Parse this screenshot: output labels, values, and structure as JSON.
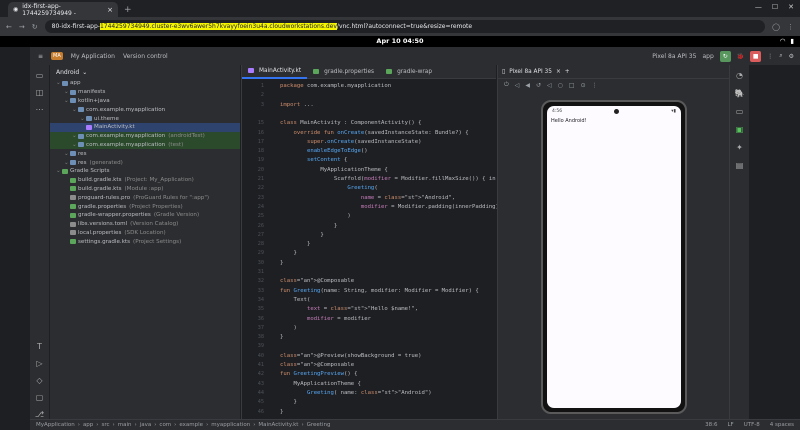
{
  "browser": {
    "tab_title": "idx-first-app-1744259734949 - ",
    "url_prefix": "80-idx-first-app-",
    "url_highlight": "1744259734949.cluster-e3wv6awer5h7kvayyfoein3u4a.cloudworkstations.dev",
    "url_suffix": "/vnc.html?autoconnect=true&resize=remote"
  },
  "os": {
    "clock": "Apr 10  04:50"
  },
  "ide": {
    "project_name": "My Application",
    "project_badge": "MA",
    "version_control": "Version control",
    "device": "Pixel 8a API 35",
    "run_config": "app",
    "project_view": "Android"
  },
  "tree": [
    {
      "label": "app",
      "extra": "",
      "indent": 0,
      "icon": "fold"
    },
    {
      "label": "manifests",
      "extra": "",
      "indent": 1,
      "icon": "fold"
    },
    {
      "label": "kotlin+java",
      "extra": "",
      "indent": 1,
      "icon": "fold"
    },
    {
      "label": "com.example.myapplication",
      "extra": "",
      "indent": 2,
      "icon": "fold"
    },
    {
      "label": "ui.theme",
      "extra": "",
      "indent": 3,
      "icon": "fold"
    },
    {
      "label": "MainActivity.kt",
      "extra": "",
      "indent": 3,
      "icon": "kt",
      "selected": true
    },
    {
      "label": "com.example.myapplication",
      "extra": "(androidTest)",
      "indent": 2,
      "icon": "fold",
      "green": true
    },
    {
      "label": "com.example.myapplication",
      "extra": "(test)",
      "indent": 2,
      "icon": "fold",
      "green": true
    },
    {
      "label": "res",
      "extra": "",
      "indent": 1,
      "icon": "fold"
    },
    {
      "label": "res",
      "extra": "(generated)",
      "indent": 1,
      "icon": "fold"
    },
    {
      "label": "Gradle Scripts",
      "extra": "",
      "indent": 0,
      "icon": "gr"
    },
    {
      "label": "build.gradle.kts",
      "extra": "(Project: My_Application)",
      "indent": 1,
      "icon": "gr"
    },
    {
      "label": "build.gradle.kts",
      "extra": "(Module :app)",
      "indent": 1,
      "icon": "gr"
    },
    {
      "label": "proguard-rules.pro",
      "extra": "(ProGuard Rules for \":app\")",
      "indent": 1,
      "icon": "txt"
    },
    {
      "label": "gradle.properties",
      "extra": "(Project Properties)",
      "indent": 1,
      "icon": "gr"
    },
    {
      "label": "gradle-wrapper.properties",
      "extra": "(Gradle Version)",
      "indent": 1,
      "icon": "gr"
    },
    {
      "label": "libs.versions.toml",
      "extra": "(Version Catalog)",
      "indent": 1,
      "icon": "txt"
    },
    {
      "label": "local.properties",
      "extra": "(SDK Location)",
      "indent": 1,
      "icon": "txt"
    },
    {
      "label": "settings.gradle.kts",
      "extra": "(Project Settings)",
      "indent": 1,
      "icon": "gr"
    }
  ],
  "editor_tabs": [
    "MainActivity.kt",
    "gradle.properties",
    "gradle-wrap"
  ],
  "code": [
    {
      "n": "1",
      "t": "package com.example.myapplication"
    },
    {
      "n": "2",
      "t": ""
    },
    {
      "n": "3",
      "t": "import ..."
    },
    {
      "n": "",
      "t": ""
    },
    {
      "n": "15",
      "t": "class MainActivity : ComponentActivity() {"
    },
    {
      "n": "16",
      "t": "    override fun onCreate(savedInstanceState: Bundle?) {"
    },
    {
      "n": "17",
      "t": "        super.onCreate(savedInstanceState)"
    },
    {
      "n": "18",
      "t": "        enableEdgeToEdge()"
    },
    {
      "n": "19",
      "t": "        setContent {"
    },
    {
      "n": "20",
      "t": "            MyApplicationTheme {"
    },
    {
      "n": "21",
      "t": "                Scaffold(modifier = Modifier.fillMaxSize()) { in"
    },
    {
      "n": "22",
      "t": "                    Greeting("
    },
    {
      "n": "23",
      "t": "                        name = \"Android\","
    },
    {
      "n": "24",
      "t": "                        modifier = Modifier.padding(innerPadding)"
    },
    {
      "n": "25",
      "t": "                    )"
    },
    {
      "n": "26",
      "t": "                }"
    },
    {
      "n": "27",
      "t": "            }"
    },
    {
      "n": "28",
      "t": "        }"
    },
    {
      "n": "29",
      "t": "    }"
    },
    {
      "n": "30",
      "t": "}"
    },
    {
      "n": "31",
      "t": ""
    },
    {
      "n": "32",
      "t": "@Composable"
    },
    {
      "n": "33",
      "t": "fun Greeting(name: String, modifier: Modifier = Modifier) {"
    },
    {
      "n": "34",
      "t": "    Text("
    },
    {
      "n": "35",
      "t": "        text = \"Hello $name!\","
    },
    {
      "n": "36",
      "t": "        modifier = modifier"
    },
    {
      "n": "37",
      "t": "    )"
    },
    {
      "n": "38",
      "t": "}"
    },
    {
      "n": "39",
      "t": ""
    },
    {
      "n": "40",
      "t": "@Preview(showBackground = true)"
    },
    {
      "n": "41",
      "t": "@Composable"
    },
    {
      "n": "42",
      "t": "fun GreetingPreview() {"
    },
    {
      "n": "43",
      "t": "    MyApplicationTheme {"
    },
    {
      "n": "44",
      "t": "        Greeting( name: \"Android\")"
    },
    {
      "n": "45",
      "t": "    }"
    },
    {
      "n": "46",
      "t": "}"
    }
  ],
  "device_tab": "Pixel 8a API 35",
  "phone": {
    "time": "4:56",
    "text": "Hello Android!"
  },
  "breadcrumbs": [
    "MyApplication",
    "app",
    "src",
    "main",
    "java",
    "com",
    "example",
    "myapplication",
    "MainActivity.kt",
    "Greeting"
  ],
  "status": {
    "pos": "38:6",
    "lf": "LF",
    "enc": "UTF-8",
    "indent": "4 spaces"
  }
}
